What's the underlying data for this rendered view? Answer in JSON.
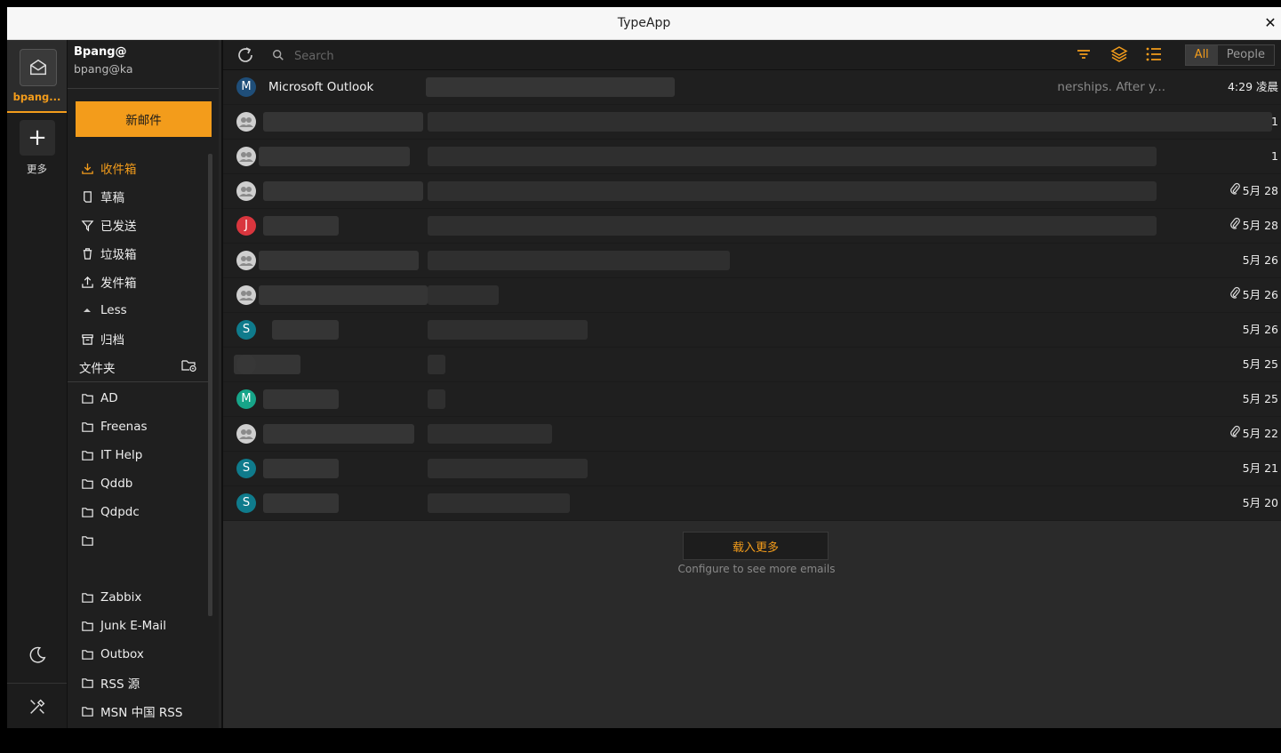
{
  "window": {
    "title": "TypeApp",
    "close_glyph": "✕"
  },
  "rail": {
    "account_label": "bpang...",
    "add_glyph": "+",
    "more_label": "更多"
  },
  "account": {
    "name": "Bpang@",
    "email": "bpang@ka"
  },
  "folders": {
    "new_mail_label": "新邮件",
    "primary": [
      {
        "label": "收件箱",
        "icon": "inbox-download-icon",
        "active": true
      },
      {
        "label": "草稿",
        "icon": "draft-icon",
        "active": false
      },
      {
        "label": "已发送",
        "icon": "sent-icon",
        "active": false
      },
      {
        "label": "垃圾箱",
        "icon": "trash-icon",
        "active": false
      },
      {
        "label": "发件箱",
        "icon": "outbox-upload-icon",
        "active": false
      },
      {
        "label": "Less",
        "icon": "triangle-up-icon",
        "active": false
      },
      {
        "label": "归档",
        "icon": "archive-icon",
        "active": false
      }
    ],
    "section_header": "文件夹",
    "custom": [
      "AD",
      "Freenas",
      "IT Help",
      "Qddb",
      "Qdpdc",
      "",
      "",
      "Zabbix",
      "Junk E-Mail",
      "Outbox",
      "RSS 源",
      "MSN 中国 RSS"
    ]
  },
  "toolbar": {
    "search_placeholder": "Search",
    "tabs": [
      "All",
      "People"
    ],
    "active_tab": "All"
  },
  "colors": {
    "accent": "#f39c1b"
  },
  "emails": [
    {
      "avatar": "M",
      "avatar_color": "#1f4e79",
      "sender": "Microsoft Outlook",
      "snippet": "nerships. After y...",
      "date": "4:29 凌晨",
      "attachment": false
    },
    {
      "avatar": "",
      "avatar_color": "#cfcfcf",
      "sender": "",
      "snippet": "",
      "date": "1",
      "attachment": false
    },
    {
      "avatar": "",
      "avatar_color": "#cfcfcf",
      "sender": "",
      "snippet": "",
      "date": "1",
      "attachment": false
    },
    {
      "avatar": "",
      "avatar_color": "#cfcfcf",
      "sender": "",
      "snippet": "",
      "date": "5月 28",
      "attachment": true
    },
    {
      "avatar": "J",
      "avatar_color": "#d9363e",
      "sender": "",
      "snippet": "",
      "date": "5月 28",
      "attachment": true
    },
    {
      "avatar": "",
      "avatar_color": "#cfcfcf",
      "sender": "",
      "snippet": "",
      "date": "5月 26",
      "attachment": false
    },
    {
      "avatar": "",
      "avatar_color": "#cfcfcf",
      "sender": "",
      "snippet": "",
      "date": "5月 26",
      "attachment": true
    },
    {
      "avatar": "S",
      "avatar_color": "#0f7b8c",
      "sender": "",
      "snippet": "",
      "date": "5月 26",
      "attachment": false
    },
    {
      "avatar": "",
      "avatar_color": "#2a2a2a",
      "sender": "",
      "snippet": "",
      "date": "5月 25",
      "attachment": false
    },
    {
      "avatar": "M",
      "avatar_color": "#17a589",
      "sender": "",
      "snippet": "",
      "date": "5月 25",
      "attachment": false
    },
    {
      "avatar": "",
      "avatar_color": "#cfcfcf",
      "sender": "",
      "snippet": "",
      "date": "5月 22",
      "attachment": true
    },
    {
      "avatar": "S",
      "avatar_color": "#0f7b8c",
      "sender": "",
      "snippet": "",
      "date": "5月 21",
      "attachment": false
    },
    {
      "avatar": "S",
      "avatar_color": "#0f7b8c",
      "sender": "",
      "snippet": "",
      "date": "5月 20",
      "attachment": false
    }
  ],
  "footer": {
    "load_more_label": "载入更多",
    "config_note": "Configure to see more emails"
  }
}
